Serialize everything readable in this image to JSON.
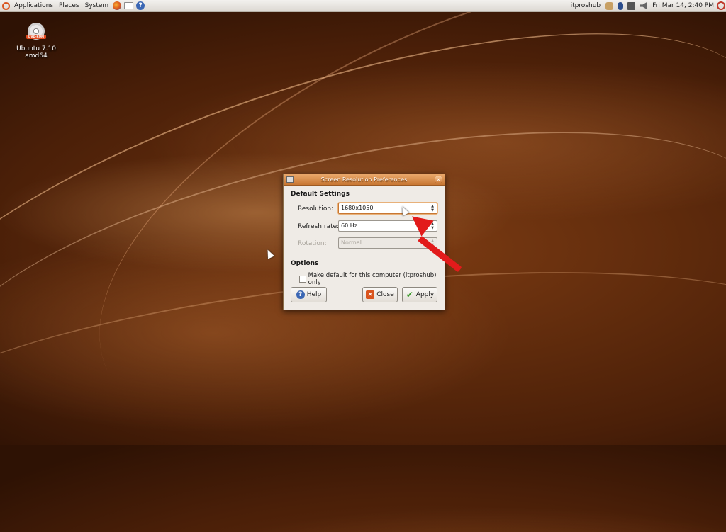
{
  "panel": {
    "menus": [
      "Applications",
      "Places",
      "System"
    ],
    "user": "itproshub",
    "clock": "Fri Mar 14,  2:40 PM"
  },
  "desktop": {
    "icon_label": "Ubuntu 7.10 amd64",
    "icon_badge": "DVD-ROM"
  },
  "dialog": {
    "title": "Screen Resolution Preferences",
    "default_settings": "Default Settings",
    "resolution_label": "Resolution:",
    "resolution_value": "1680x1050",
    "refresh_label": "Refresh rate:",
    "refresh_value": "60 Hz",
    "rotation_label": "Rotation:",
    "rotation_value": "Normal",
    "options": "Options",
    "make_default": "Make default for this computer (itproshub) only",
    "help_button": "Help",
    "close_button": "Close",
    "apply_button": "Apply"
  },
  "colors": {
    "accent": "#c87733",
    "arrow": "#e21b1b"
  }
}
